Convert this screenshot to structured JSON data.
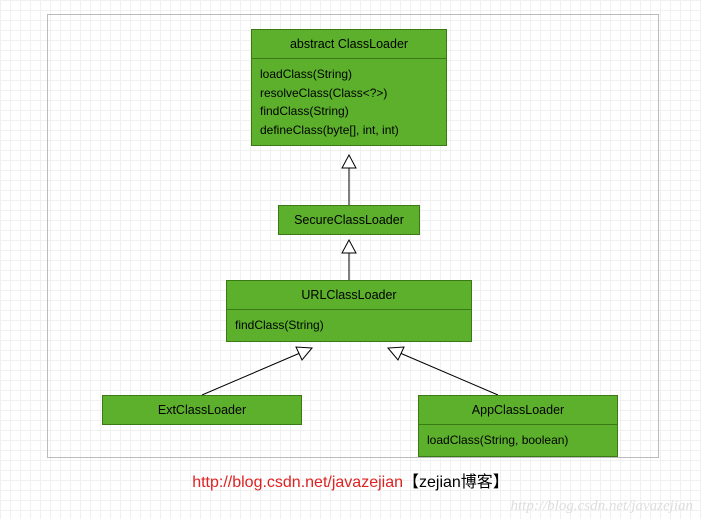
{
  "classes": {
    "abstractClassLoader": {
      "title": "abstract ClassLoader",
      "methods": [
        "loadClass(String)",
        "resolveClass(Class<?>)",
        "findClass(String)",
        "defineClass(byte[], int, int)"
      ]
    },
    "secureClassLoader": {
      "title": "SecureClassLoader"
    },
    "urlClassLoader": {
      "title": "URLClassLoader",
      "methods": [
        "findClass(String)"
      ]
    },
    "extClassLoader": {
      "title": "ExtClassLoader"
    },
    "appClassLoader": {
      "title": "AppClassLoader",
      "methods": [
        "loadClass(String, boolean)"
      ]
    }
  },
  "attribution": {
    "url": "http://blog.csdn.net/javazejian",
    "bracket": "【zejian博客】"
  },
  "watermark": "http://blog.csdn.net/javazejian"
}
